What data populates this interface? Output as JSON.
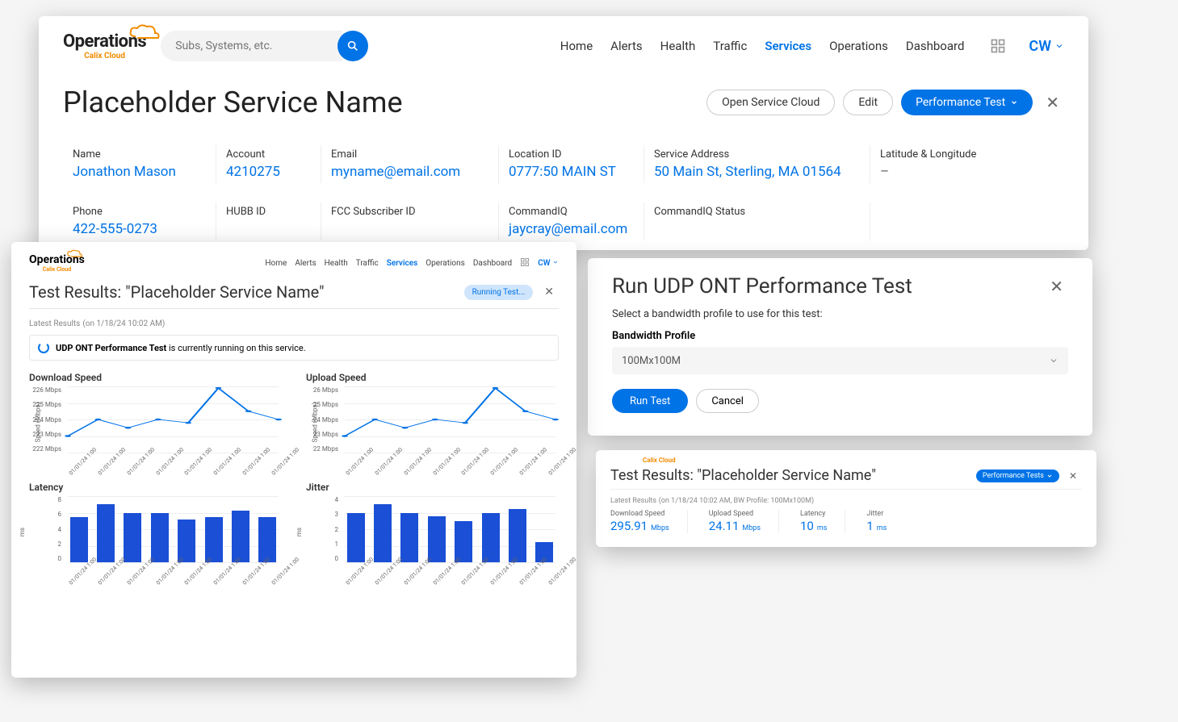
{
  "brand": {
    "name": "Operations",
    "sub": "Calix Cloud"
  },
  "search": {
    "placeholder": "Subs, Systems, etc."
  },
  "nav": [
    "Home",
    "Alerts",
    "Health",
    "Traffic",
    "Services",
    "Operations",
    "Dashboard"
  ],
  "nav_active_idx": 4,
  "user": "CW",
  "page_title": "Placeholder Service Name",
  "actions": {
    "open": "Open Service Cloud",
    "edit": "Edit",
    "perf": "Performance Test"
  },
  "info": {
    "row1": [
      {
        "label": "Name",
        "value": "Jonathon Mason"
      },
      {
        "label": "Account",
        "value": "4210275"
      },
      {
        "label": "Email",
        "value": "myname@email.com"
      },
      {
        "label": "Location ID",
        "value": "0777:50 MAIN ST"
      },
      {
        "label": "Service Address",
        "value": "50 Main St, Sterling, MA 01564"
      },
      {
        "label": "Latitude & Longitude",
        "value": "–",
        "muted": true
      }
    ],
    "row2": [
      {
        "label": "Phone",
        "value": "422-555-0273"
      },
      {
        "label": "HUBB ID",
        "value": ""
      },
      {
        "label": "FCC Subscriber ID",
        "value": ""
      },
      {
        "label": "CommandIQ",
        "value": "jaycray@email.com"
      },
      {
        "label": "CommandIQ Status",
        "value": ""
      },
      {
        "label": "",
        "value": ""
      }
    ]
  },
  "results": {
    "title": "Test Results: \"Placeholder Service Name\"",
    "running_btn": "Running Test...",
    "latest_label": "Latest Results",
    "latest_meta": "(on 1/18/24 10:02 AM)",
    "status_bold": "UDP ONT Performance Test",
    "status_rest": " is currently running on this service."
  },
  "chart_data": [
    {
      "type": "line",
      "title": "Download Speed",
      "ylabel": "Speed (Mbps)",
      "ylim": [
        222,
        226
      ],
      "yticks": [
        "226 Mbps",
        "225 Mbps",
        "224 Mbps",
        "223 Mbps",
        "222 Mbps"
      ],
      "categories": [
        "01/01/24 1:00",
        "01/01/24 1:00",
        "01/01/24 1:00",
        "01/01/24 1:00",
        "01/01/24 1:00",
        "01/01/24 1:00",
        "01/01/24 1:00",
        "01/01/24 1:00"
      ],
      "values": [
        223,
        224,
        223.5,
        224,
        223.8,
        225.9,
        224.5,
        224
      ]
    },
    {
      "type": "line",
      "title": "Upload Speed",
      "ylabel": "Speed (Mbps)",
      "ylim": [
        22,
        26
      ],
      "yticks": [
        "26 Mbps",
        "25 Mbps",
        "24 Mbps",
        "23 Mbps",
        "22 Mbps"
      ],
      "categories": [
        "01/01/24 1:00",
        "01/01/24 1:00",
        "01/01/24 1:00",
        "01/01/24 1:00",
        "01/01/24 1:00",
        "01/01/24 1:00",
        "01/01/24 1:00",
        "01/01/24 1:00"
      ],
      "values": [
        23,
        24,
        23.5,
        24,
        23.8,
        25.9,
        24.5,
        24
      ]
    },
    {
      "type": "bar",
      "title": "Latency",
      "ylabel": "ms",
      "ylim": [
        0,
        8
      ],
      "yticks": [
        "8",
        "6",
        "4",
        "2",
        "0"
      ],
      "categories": [
        "01/01/24 1:00",
        "01/01/24 1:00",
        "01/01/24 1:00",
        "01/01/24 1:00",
        "01/01/24 1:00",
        "01/01/24 1:00",
        "01/01/24 1:00",
        "01/01/24 1:00"
      ],
      "values": [
        5.5,
        7,
        6,
        6,
        5.2,
        5.5,
        6.2,
        5.5
      ]
    },
    {
      "type": "bar",
      "title": "Jitter",
      "ylabel": "ms",
      "ylim": [
        0,
        4
      ],
      "yticks": [
        "4",
        "3",
        "2",
        "1",
        "0"
      ],
      "categories": [
        "01/01/24 1:00",
        "01/01/24 1:00",
        "01/01/24 1:00",
        "01/01/24 1:00",
        "01/01/24 1:00",
        "01/01/24 1:00",
        "01/01/24 1:00",
        "01/01/24 1:00"
      ],
      "values": [
        3,
        3.5,
        3,
        2.8,
        2.5,
        3,
        3.2,
        1.2
      ]
    }
  ],
  "modal": {
    "title": "Run UDP ONT Performance Test",
    "sub": "Select a bandwidth profile to use for this test:",
    "field_label": "Bandwidth Profile",
    "selected": "100Mx100M",
    "run": "Run Test",
    "cancel": "Cancel"
  },
  "summary": {
    "title": "Test Results: \"Placeholder Service Name\"",
    "btn": "Performance Tests",
    "latest_label": "Latest Results",
    "latest_meta": "(on 1/18/24 10:02 AM, BW Profile: 100Mx100M)",
    "metrics": [
      {
        "label": "Download Speed",
        "value": "295.91",
        "unit": "Mbps"
      },
      {
        "label": "Upload Speed",
        "value": "24.11",
        "unit": "Mbps"
      },
      {
        "label": "Latency",
        "value": "10",
        "unit": "ms"
      },
      {
        "label": "Jitter",
        "value": "1",
        "unit": "ms"
      }
    ]
  }
}
